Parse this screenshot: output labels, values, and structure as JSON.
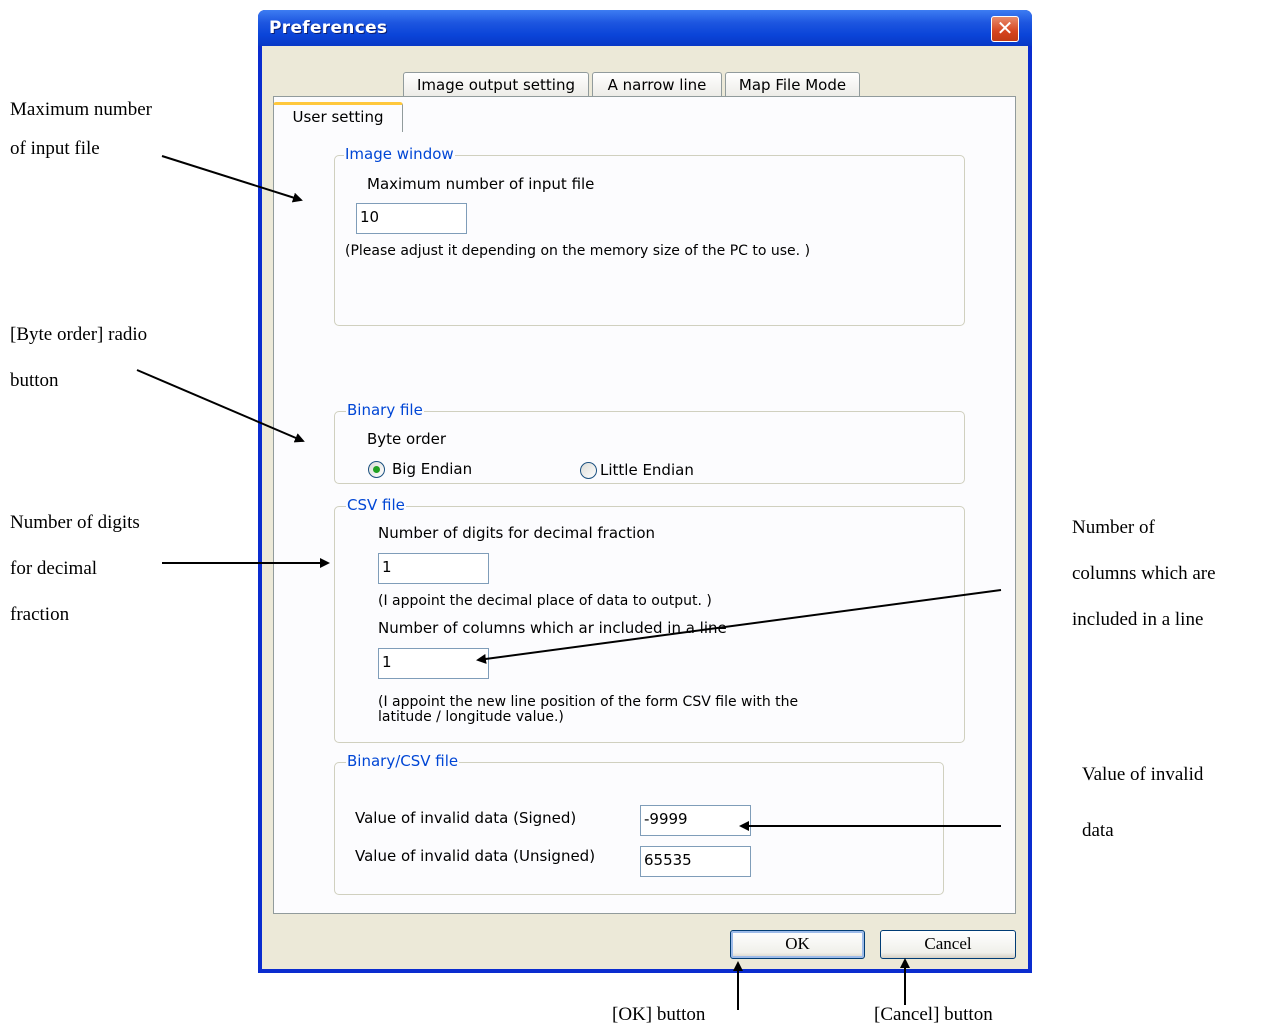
{
  "window": {
    "title": "Preferences",
    "close_glyph": "✕"
  },
  "tabs": [
    {
      "label": "User setting",
      "active": true
    },
    {
      "label": "Image output setting",
      "active": false
    },
    {
      "label": "A narrow line",
      "active": false
    },
    {
      "label": "Map File Mode",
      "active": false
    }
  ],
  "image_window": {
    "legend": "Image window",
    "max_input_label": "Maximum number of input file",
    "max_input_value": "10",
    "note": "(Please adjust it depending on the memory size of the PC to use. )"
  },
  "binary_file": {
    "legend": "Binary file",
    "byte_order_label": "Byte order",
    "options": [
      {
        "label": "Big Endian",
        "selected": true
      },
      {
        "label": "Little Endian",
        "selected": false
      }
    ]
  },
  "csv_file": {
    "legend": "CSV file",
    "digits_label": "Number of digits for decimal fraction",
    "digits_value": "1",
    "digits_note": "(I appoint the decimal place of data to output. )",
    "columns_label": "Number of columns which ar included in a line",
    "columns_value": "1",
    "columns_note_line1": "(I appoint the new line position of the form CSV file with the",
    "columns_note_line2": "latitude / longitude value.)"
  },
  "binary_csv_file": {
    "legend": "Binary/CSV file",
    "signed_label": "Value of invalid data (Signed)",
    "signed_value": "-9999",
    "unsigned_label": "Value of invalid data (Unsigned)",
    "unsigned_value": "65535"
  },
  "buttons": {
    "ok": "OK",
    "cancel": "Cancel"
  },
  "annotations": {
    "max_input_line1": "Maximum  number",
    "max_input_line2": "of input file",
    "byte_order_line1": "[Byte  order]  radio",
    "byte_order_line2": "button",
    "digits_line1": "Number of digits",
    "digits_line2": "for decimal",
    "digits_line3": "fraction",
    "columns_line1": "Number of",
    "columns_line2": "columns which are",
    "columns_line3": "included in a line",
    "invalid_line1": "Value of invalid",
    "invalid_line2": "data",
    "ok_button": "[OK] button",
    "cancel_button": "[Cancel] button"
  },
  "colors": {
    "titlebar": "#0a44d8",
    "legend_text": "#0046d5",
    "dialog_bg": "#ece9d8",
    "active_tab_accent": "#ffc83c"
  }
}
